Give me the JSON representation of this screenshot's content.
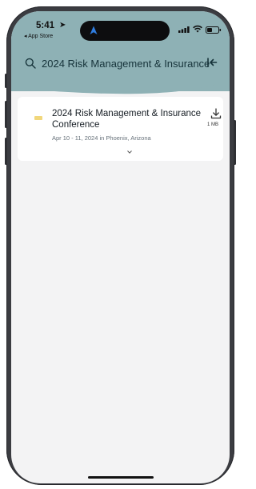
{
  "status_bar": {
    "time": "5:41",
    "location_icon": "location-arrow-icon",
    "back_app": "◂ App Store"
  },
  "search": {
    "query": "2024 Risk Management & Insurance"
  },
  "results": [
    {
      "title": "2024 Risk Management & Insurance Conference",
      "subtitle": "Apr 10 - 11, 2024 in Phoenix, Arizona",
      "download_size": "1 MB"
    }
  ],
  "colors": {
    "header": "#8eb1b5",
    "background": "#f3f3f4",
    "card": "#ffffff"
  }
}
